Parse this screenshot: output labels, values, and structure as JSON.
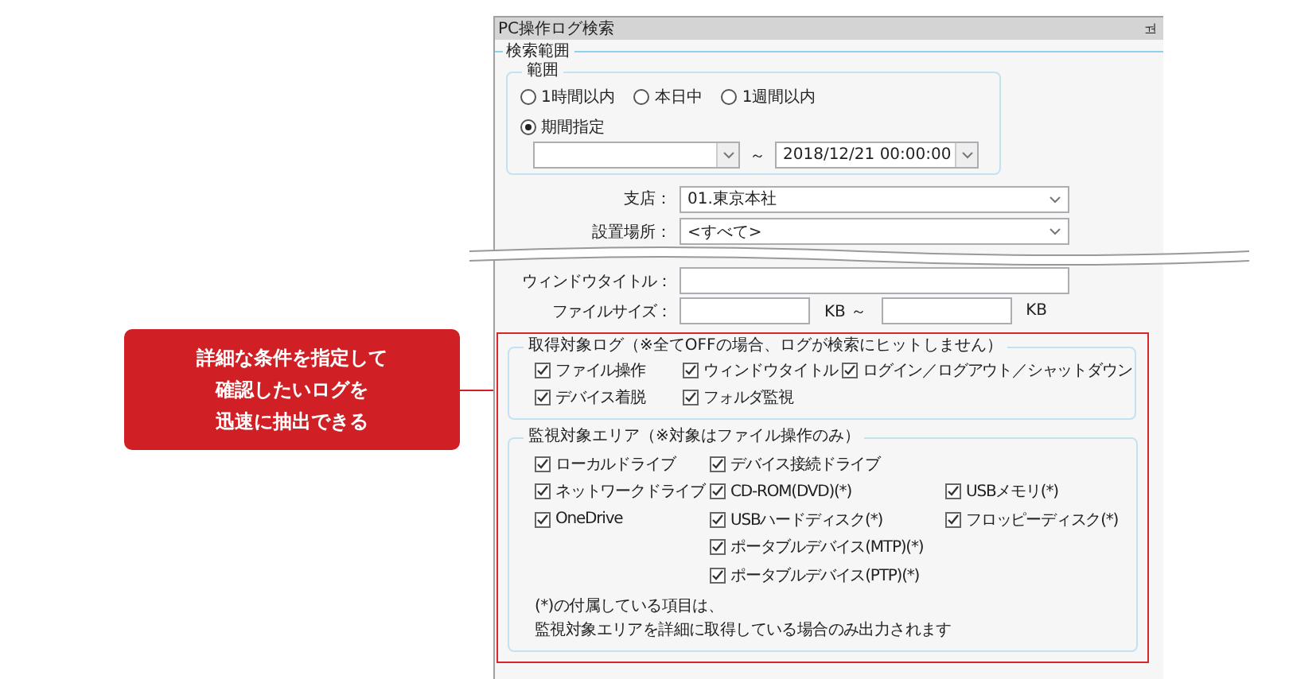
{
  "callout": {
    "lines": [
      "詳細な条件を指定して",
      "確認したいログを",
      "迅速に抽出できる"
    ]
  },
  "panel": {
    "title": "PC操作ログ検索",
    "pin": "ᆋ"
  },
  "search_scope": {
    "legend": "検索範囲",
    "range": {
      "legend": "範囲",
      "options": [
        {
          "label": "1時間以内",
          "selected": false
        },
        {
          "label": "本日中",
          "selected": false
        },
        {
          "label": "1週間以内",
          "selected": false
        },
        {
          "label": "期間指定",
          "selected": true
        }
      ],
      "separator": "～",
      "date_to": {
        "value": "2018/12/21 00:00:00"
      }
    }
  },
  "fields": [
    {
      "kind": "combo",
      "label": "支店：",
      "value": "01.東京本社"
    },
    {
      "kind": "combo",
      "label": "設置場所：",
      "value": "<すべて>"
    },
    {
      "kind": "text",
      "label": "ウィンドウタイトル："
    },
    {
      "kind": "range",
      "label": "ファイルサイズ：",
      "unit_from": "KB ～",
      "unit_to": "KB"
    }
  ],
  "log_targets": {
    "legend": "取得対象ログ（※全てOFFの場合、ログが検索にヒットしません）",
    "columns": [
      [
        {
          "label": "ファイル操作",
          "checked": true
        },
        {
          "label": "デバイス着脱",
          "checked": true
        }
      ],
      [
        {
          "label": "ウィンドウタイトル",
          "checked": true
        },
        {
          "label": "フォルダ監視",
          "checked": true
        }
      ],
      [
        {
          "label": "ログイン／ログアウト／シャットダウン",
          "checked": true
        }
      ]
    ]
  },
  "monitor_areas": {
    "legend": "監視対象エリア（※対象はファイル操作のみ）",
    "columns": [
      [
        {
          "label": "ローカルドライブ",
          "checked": true
        },
        {
          "label": "ネットワークドライブ",
          "checked": true
        },
        {
          "label": "OneDrive",
          "checked": true
        }
      ],
      [
        {
          "label": "デバイス接続ドライブ",
          "checked": true
        },
        {
          "label": "CD-ROM(DVD)(*)",
          "checked": true
        },
        {
          "label": "USBハードディスク(*)",
          "checked": true
        },
        {
          "label": "ポータブルデバイス(MTP)(*)",
          "checked": true
        },
        {
          "label": "ポータブルデバイス(PTP)(*)",
          "checked": true
        }
      ],
      [
        {
          "label": "USBメモリ(*)",
          "checked": true
        },
        {
          "label": "フロッピーディスク(*)",
          "checked": true
        }
      ]
    ],
    "note": [
      "(*)の付属している項目は、",
      "監視対象エリアを詳細に取得している場合のみ出力されます"
    ]
  }
}
